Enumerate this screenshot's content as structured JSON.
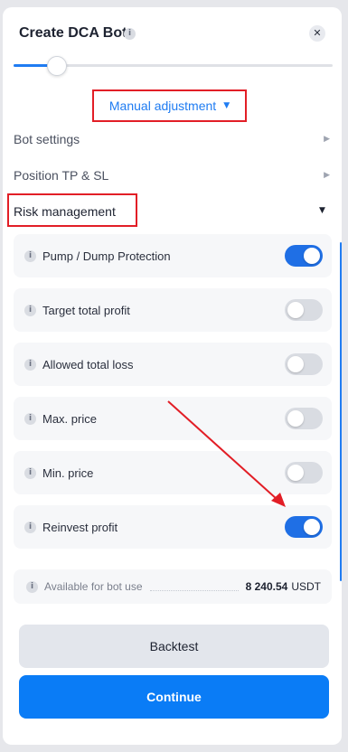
{
  "dialog": {
    "title": "Create DCA Bot",
    "info_glyph": "i",
    "close_glyph": "✕"
  },
  "slider": {
    "fill_fraction": 0.14
  },
  "mode": {
    "label": "Manual adjustment",
    "caret": "▼"
  },
  "sections": [
    {
      "label": "Bot settings",
      "arrow": "▶"
    },
    {
      "label": "Position TP & SL",
      "arrow": "▶"
    }
  ],
  "risk": {
    "label": "Risk management",
    "caret": "▼"
  },
  "options": [
    {
      "label": "Pump / Dump Protection",
      "enabled": true
    },
    {
      "label": "Target total profit",
      "enabled": false
    },
    {
      "label": "Allowed total loss",
      "enabled": false
    },
    {
      "label": "Max. price",
      "enabled": false
    },
    {
      "label": "Min. price",
      "enabled": false
    },
    {
      "label": "Reinvest profit",
      "enabled": true
    }
  ],
  "available": {
    "label": "Available for bot use",
    "value": "8 240.54",
    "unit": "USDT"
  },
  "buttons": {
    "backtest": "Backtest",
    "continue": "Continue"
  },
  "colors": {
    "accent": "#1f7cf2",
    "highlight": "#e21e26",
    "toggle_on": "#1f6fe5",
    "toggle_off": "#d9dce2"
  }
}
